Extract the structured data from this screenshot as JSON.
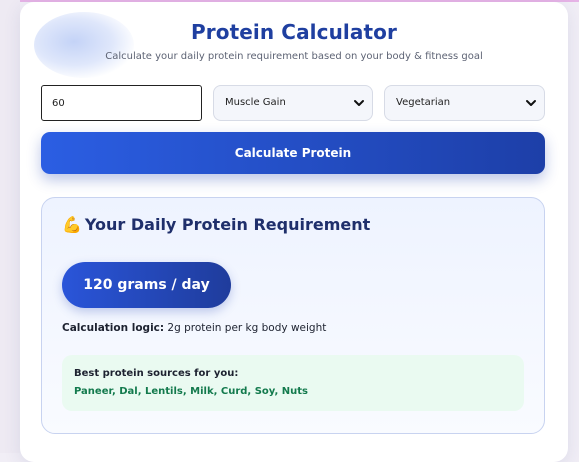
{
  "header": {
    "title": "Protein Calculator",
    "subtitle": "Calculate your daily protein requirement based on your body & fitness goal"
  },
  "form": {
    "weight_value": "60",
    "goal_selected": "Muscle Gain",
    "diet_selected": "Vegetarian",
    "calculate_label": "Calculate Protein"
  },
  "result": {
    "emoji": "💪",
    "heading": "Your Daily Protein Requirement",
    "amount": "120 grams / day",
    "logic_label": "Calculation logic:",
    "logic_text": " 2g protein per kg body weight",
    "sources_title": "Best protein sources for you:",
    "sources_list": "Paneer, Dal, Lentils, Milk, Curd, Soy, Nuts"
  },
  "colors": {
    "accent": "#1f3fa0",
    "button": "#2b5ee3",
    "sources_text": "#137a4d",
    "sources_bg": "#eafaf1"
  },
  "icons": {
    "dropdown": "chevron-down-icon",
    "heading": "flexed-biceps-icon"
  }
}
